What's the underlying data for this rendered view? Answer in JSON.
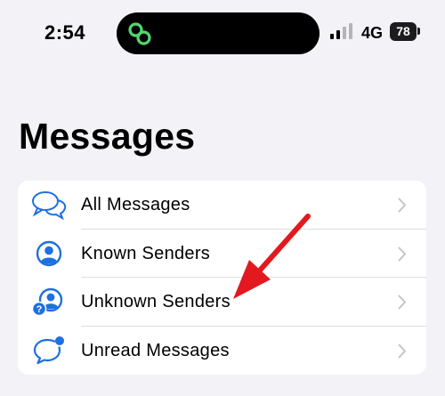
{
  "status_bar": {
    "time": "2:54",
    "network": "4G",
    "battery": "78",
    "island_icon": "link-icon",
    "accent": "#53d66b"
  },
  "page": {
    "title": "Messages"
  },
  "list": {
    "items": [
      {
        "label": "All Messages",
        "icon": "chat-bubbles-icon"
      },
      {
        "label": "Known Senders",
        "icon": "person-circle-icon"
      },
      {
        "label": "Unknown Senders",
        "icon": "unknown-person-icon"
      },
      {
        "label": "Unread Messages",
        "icon": "unread-bubble-icon"
      }
    ]
  },
  "colors": {
    "accent_blue": "#1e6fe0",
    "annotation_red": "#e3191f",
    "background": "#f2f2f7"
  }
}
